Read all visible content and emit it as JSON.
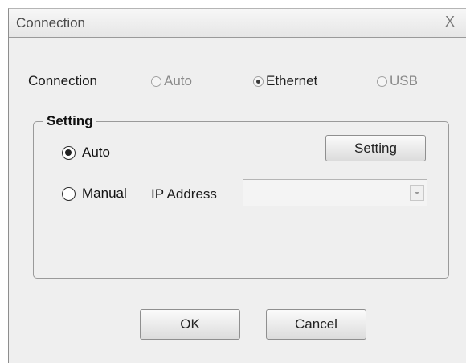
{
  "window": {
    "title": "Connection",
    "close_glyph": "X"
  },
  "connection": {
    "label": "Connection",
    "options": [
      {
        "label": "Auto",
        "checked": false,
        "enabled": false
      },
      {
        "label": "Ethernet",
        "checked": true,
        "enabled": true
      },
      {
        "label": "USB",
        "checked": false,
        "enabled": false
      }
    ]
  },
  "setting_group": {
    "legend": "Setting",
    "auto_label": "Auto",
    "auto_checked": true,
    "manual_label": "Manual",
    "manual_checked": false,
    "ip_label": "IP Address",
    "ip_value": "",
    "setting_button": "Setting"
  },
  "footer": {
    "ok_label": "OK",
    "cancel_label": "Cancel"
  },
  "icons": [
    "close-icon",
    "chevron-down-icon"
  ]
}
